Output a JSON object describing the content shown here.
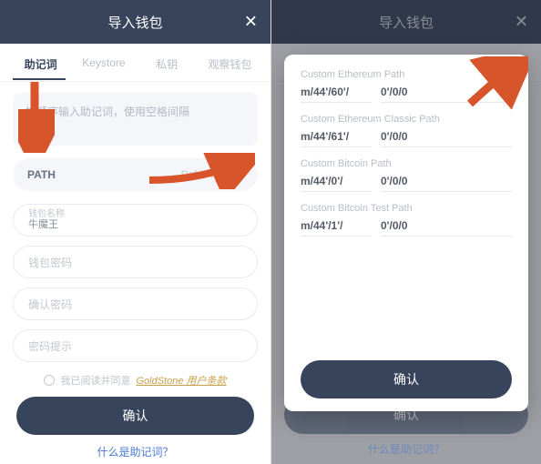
{
  "header": {
    "title": "导入钱包",
    "close": "✕"
  },
  "tabs": {
    "items": [
      "助记词",
      "Keystore",
      "私钥",
      "观察钱包"
    ],
    "active_index": 0
  },
  "left": {
    "mnemonic_placeholder": "按顺序输入助记词，使用空格间隔",
    "path": {
      "label": "PATH",
      "value": "Default Path",
      "chevron": "›"
    },
    "fields": {
      "name_label": "钱包名称",
      "name_value": "牛魔王",
      "pwd_placeholder": "钱包密码",
      "pwd2_placeholder": "确认密码",
      "hint_placeholder": "密码提示"
    },
    "terms": {
      "prefix": "我已阅读并同意",
      "link": "GoldStone 用户条款"
    },
    "confirm": "确认",
    "help": "什么是助记词？"
  },
  "right": {
    "paths": [
      {
        "title": "Custom Ethereum Path",
        "left": "m/44'/60'/",
        "right": "0'/0/0"
      },
      {
        "title": "Custom Ethereum Classic Path",
        "left": "m/44'/61'/",
        "right": "0'/0/0"
      },
      {
        "title": "Custom Bitcoin Path",
        "left": "m/44'/0'/",
        "right": "0'/0/0"
      },
      {
        "title": "Custom Bitcoin Test Path",
        "left": "m/44'/1'/",
        "right": "0'/0/0"
      }
    ],
    "confirm": "确认",
    "bg_confirm": "确认",
    "bg_help": "什么是助记词？"
  }
}
